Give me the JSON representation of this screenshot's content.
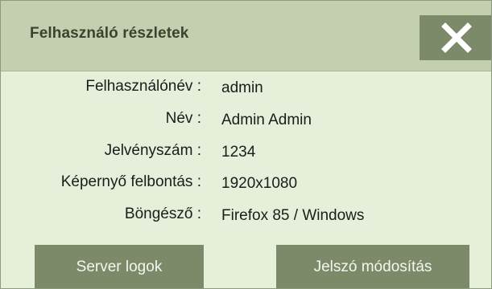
{
  "dialog": {
    "title": "Felhasználó részletek",
    "close_icon": "close-icon"
  },
  "details": [
    {
      "label": "Felhasználónév :",
      "value": "admin"
    },
    {
      "label": "Név :",
      "value": "Admin Admin"
    },
    {
      "label": "Jelvényszám :",
      "value": "1234"
    },
    {
      "label": "Képernyő felbontás :",
      "value": "1920x1080"
    },
    {
      "label": "Böngésző :",
      "value": "Firefox 85 / Windows"
    }
  ],
  "buttons": {
    "server_logs": "Server logok",
    "change_password": "Jelszó módosítás"
  },
  "colors": {
    "body_bg": "#e6efd9",
    "header_bg": "#c3cfaf",
    "button_bg": "#7d8a69",
    "button_text": "#f4f6ef",
    "title_text": "#3d4230"
  }
}
